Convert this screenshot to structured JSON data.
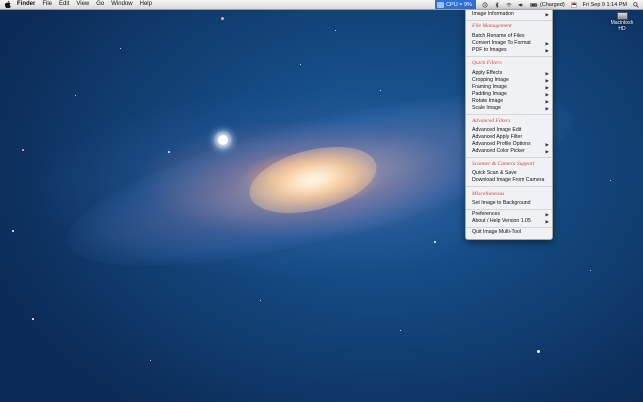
{
  "menubar": {
    "apple_icon": "apple-icon",
    "items": [
      "Finder",
      "File",
      "Edit",
      "View",
      "Go",
      "Window",
      "Help"
    ],
    "status": {
      "app_label": "CPU = 9%",
      "battery_label": "(Charged)",
      "datetime": "Fri Sep 9  1:14 PM",
      "icons": [
        "time-machine-icon",
        "bluetooth-icon",
        "wifi-icon",
        "volume-icon",
        "battery-icon",
        "flag-icon",
        "search-icon"
      ]
    }
  },
  "desktop": {
    "drive_label_line1": "Macintosh",
    "drive_label_line2": "HD"
  },
  "dropdown": {
    "item_image_information": "Image Information",
    "section_file_management": "File Management",
    "item_batch_rename": "Batch Rename of Files",
    "item_convert_image": "Convert Image To Format",
    "item_pdf_to_images": "PDF to Images",
    "section_quick_filters": "Quick Filters",
    "item_apply_effects": "Apply Effects",
    "item_cropping_image": "Cropping Image",
    "item_framing_image": "Framing Image",
    "item_padding_image": "Padding Image",
    "item_rotate_image": "Rotate Image",
    "item_scale_image": "Scale Image",
    "section_advanced_filters": "Advanced Filters",
    "item_advanced_image_edit": "Advanced Image Edit",
    "item_advanced_apply_filter": "Advanced Apply Filter",
    "item_advanced_profile_options": "Advanced Profile Options",
    "item_advanced_color_picker": "Advanced Color Picker",
    "section_scanner": "Scanner & Camera Support",
    "item_quick_scan": "Quick Scan & Save",
    "item_download_image": "Download Image From Camera",
    "section_miscellaneous": "Miscellaneous",
    "item_set_background": "Set Image to Background",
    "item_preferences": "Preferences",
    "item_about_help": "About / Help Version 1.05",
    "item_quit": "Quit Image Multi-Tool",
    "submenu_arrow": "▶"
  }
}
